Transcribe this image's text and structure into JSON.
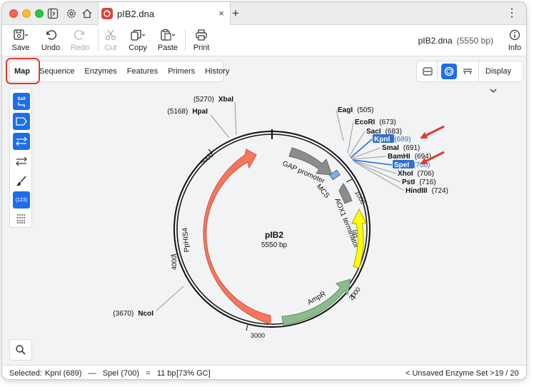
{
  "window": {
    "tab_title": "pIB2.dna",
    "new_tab_symbol": "+",
    "close_symbol": "×",
    "menu_symbol": "⋮"
  },
  "toolbar": {
    "save": "Save",
    "undo": "Undo",
    "redo": "Redo",
    "cut": "Cut",
    "copy": "Copy",
    "paste": "Paste",
    "print": "Print",
    "info": "Info"
  },
  "doc": {
    "name": "pIB2.dna",
    "size": "(5550 bp)"
  },
  "view_tabs": [
    "Map",
    "Sequence",
    "Enzymes",
    "Features",
    "Primers",
    "History"
  ],
  "display_label": "Display",
  "palette": {
    "enzyme_badge": "SalI",
    "numbers_badge": "(123)"
  },
  "map": {
    "name": "pIB2",
    "length": "5550 bp",
    "ticks": [
      "1000",
      "2000",
      "3000",
      "4000",
      "5000"
    ],
    "features": {
      "gap_promoter": "GAP promoter",
      "aox1_terminator": "AOX1 terminator",
      "ori": "ori",
      "ampr": "AmpR",
      "pphis4": "PpHIS4",
      "mcs": "MCS"
    },
    "enzymes_left": [
      {
        "pos": "(5270)",
        "name": "XbaI"
      },
      {
        "pos": "(5168)",
        "name": "HpaI"
      },
      {
        "pos": "(3670)",
        "name": "NcoI"
      }
    ],
    "enzymes_right": [
      {
        "name": "EagI",
        "pos": "(505)",
        "highlight": false
      },
      {
        "name": "EcoRI",
        "pos": "(673)",
        "highlight": false
      },
      {
        "name": "SacI",
        "pos": "(683)",
        "highlight": false
      },
      {
        "name": "KpnI",
        "pos": "(689)",
        "highlight": true
      },
      {
        "name": "SmaI",
        "pos": "(691)",
        "highlight": false
      },
      {
        "name": "BamHI",
        "pos": "(694)",
        "highlight": false
      },
      {
        "name": "SpeI",
        "pos": "(700)",
        "highlight": true
      },
      {
        "name": "XhoI",
        "pos": "(706)",
        "highlight": false
      },
      {
        "name": "PstI",
        "pos": "(716)",
        "highlight": false
      },
      {
        "name": "HindIII",
        "pos": "(724)",
        "highlight": false
      }
    ]
  },
  "status": {
    "selected": "Selected:",
    "selection": "KpnI (689)   —   SpeI (700)   =   11 bp",
    "gc": "[73% GC]",
    "enzyme_set": "< Unsaved Enzyme Set >",
    "count": "19 / 20"
  },
  "colors": {
    "accent": "#1e6ee8",
    "annotation_red": "#e23b2a",
    "pphis4": "#f7765c",
    "gap_promoter": "#8c8c8c",
    "ori": "#ffff00",
    "ampr": "#8dbb8d"
  }
}
